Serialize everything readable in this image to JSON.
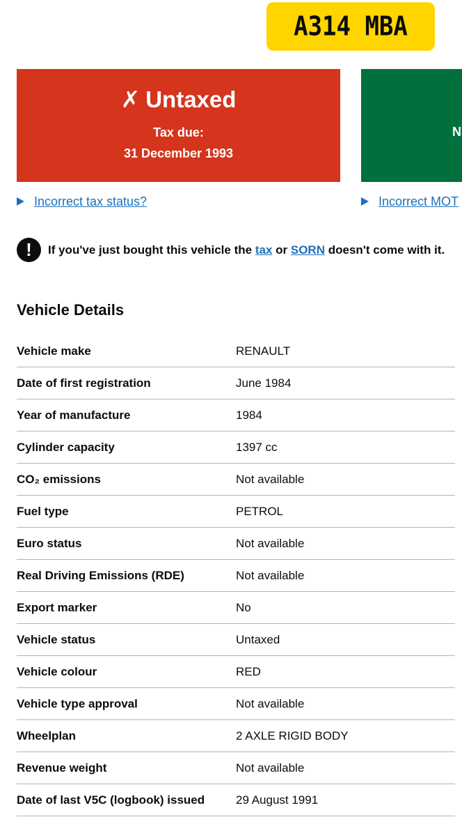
{
  "registration": "A314 MBA",
  "tax": {
    "status": "Untaxed",
    "cross_glyph": "✗",
    "due_label": "Tax due:",
    "due_date": "31 December 1993",
    "incorrect_link": "Incorrect tax status?",
    "color": "#d4351c"
  },
  "mot": {
    "partial_text": "N",
    "incorrect_link": "Incorrect MOT",
    "color": "#00703c"
  },
  "warning": {
    "icon": "!",
    "text_before": "If you've just bought this vehicle the",
    "tax_link": "tax",
    "or": "or",
    "sorn_link": "SORN",
    "text_after": "doesn't come with it."
  },
  "vehicle_details": {
    "title": "Vehicle Details",
    "rows": [
      {
        "label": "Vehicle make",
        "value": "RENAULT"
      },
      {
        "label": "Date of first registration",
        "value": "June 1984"
      },
      {
        "label": "Year of manufacture",
        "value": "1984"
      },
      {
        "label": "Cylinder capacity",
        "value": "1397 cc"
      },
      {
        "label": "CO₂ emissions",
        "value": "Not available"
      },
      {
        "label": "Fuel type",
        "value": "PETROL"
      },
      {
        "label": "Euro status",
        "value": "Not available"
      },
      {
        "label": "Real Driving Emissions (RDE)",
        "value": "Not available"
      },
      {
        "label": "Export marker",
        "value": "No"
      },
      {
        "label": "Vehicle status",
        "value": "Untaxed"
      },
      {
        "label": "Vehicle colour",
        "value": "RED"
      },
      {
        "label": "Vehicle type approval",
        "value": "Not available"
      },
      {
        "label": "Wheelplan",
        "value": "2 AXLE RIGID BODY"
      },
      {
        "label": "Revenue weight",
        "value": "Not available"
      },
      {
        "label": "Date of last V5C (logbook) issued",
        "value": "29 August 1991"
      }
    ]
  },
  "colors": {
    "link": "#1d70b8",
    "plate": "#ffd500",
    "text": "#0b0c0c",
    "divider": "#b1b4b6"
  }
}
